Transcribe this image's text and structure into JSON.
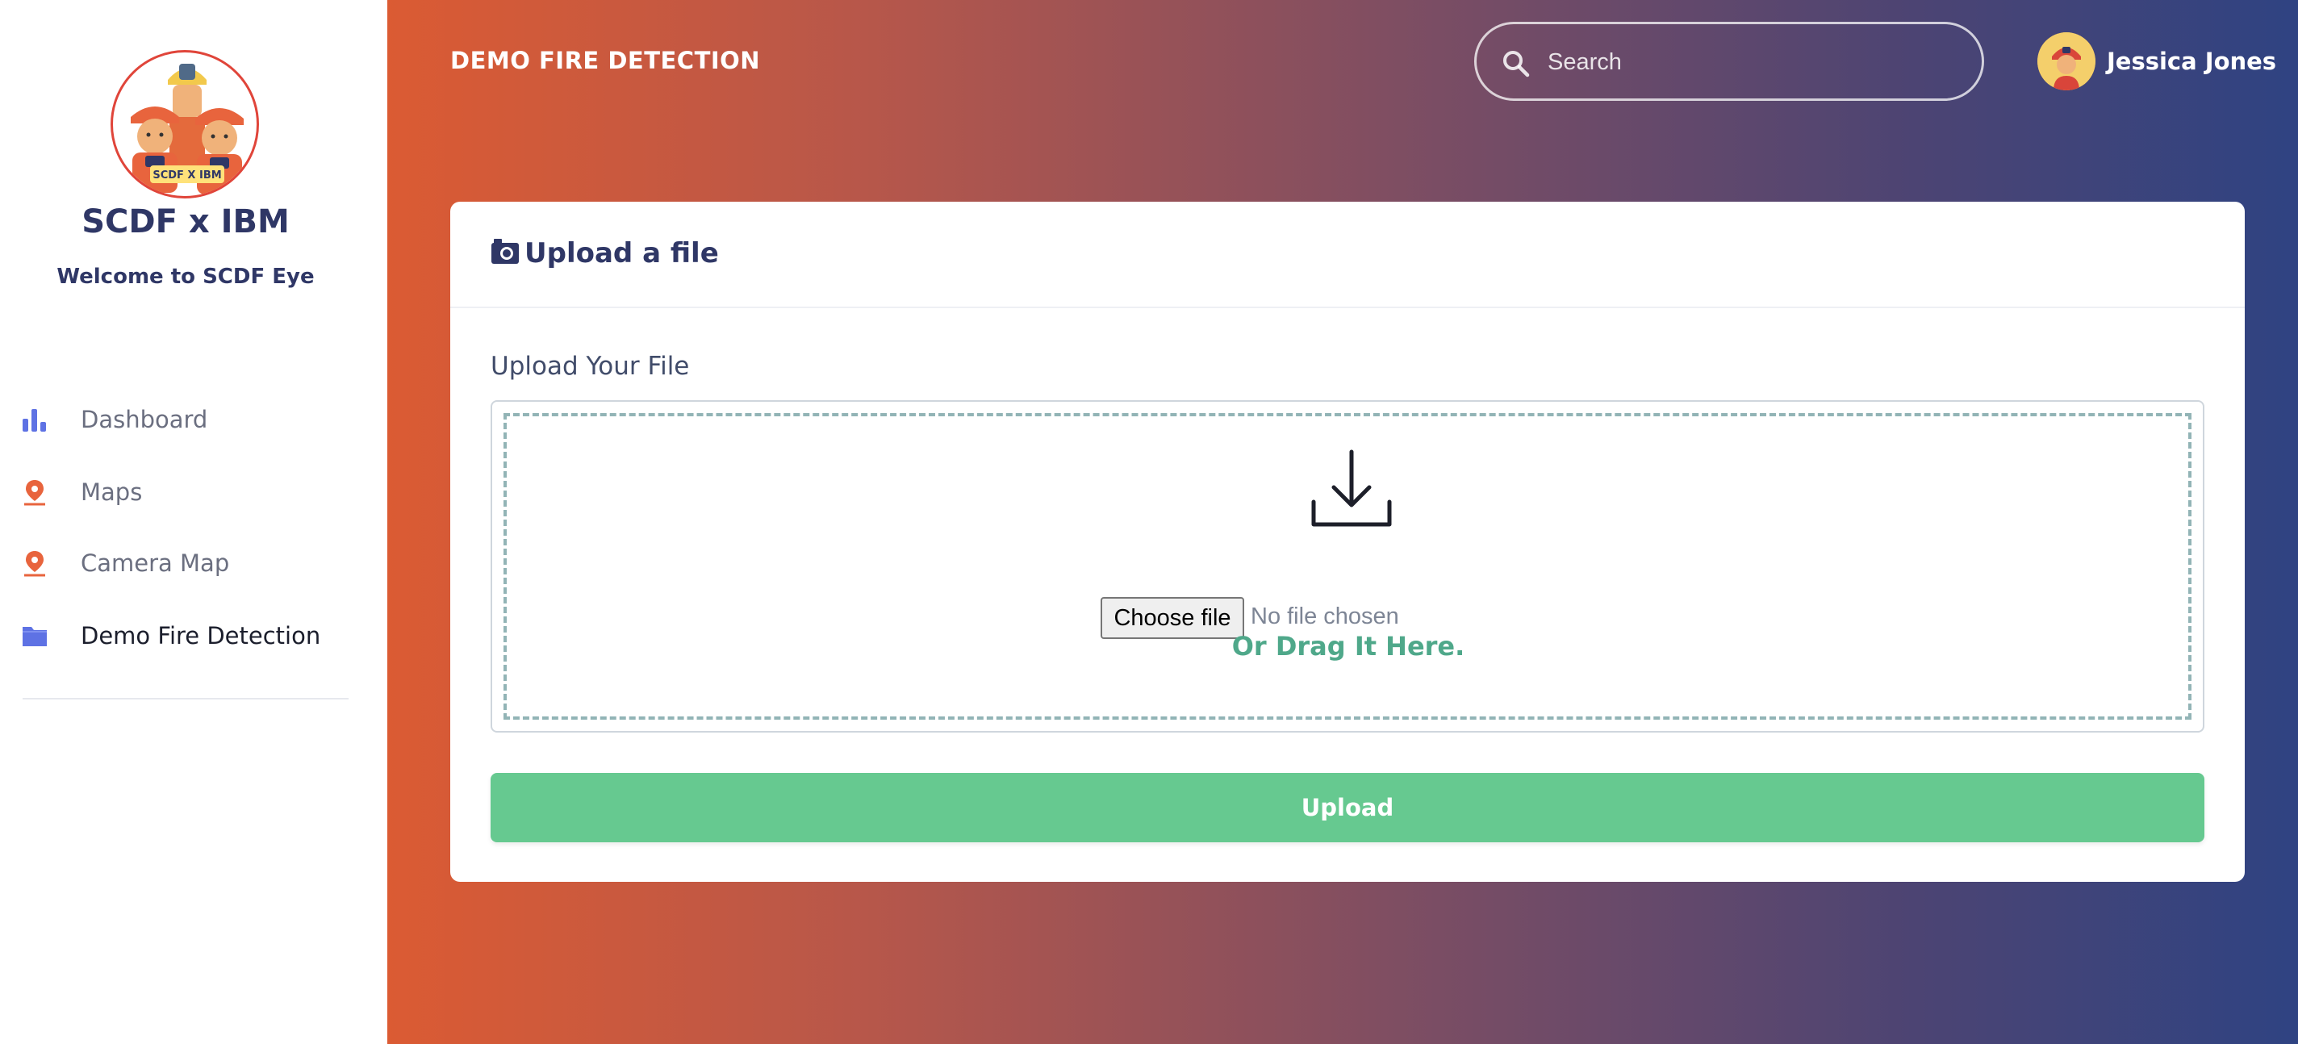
{
  "sidebar": {
    "brand": {
      "logo_text": "SCDF X IBM",
      "title": "SCDF x IBM",
      "welcome_prefix": "Welcome to",
      "welcome_name": "SCDF Eye"
    },
    "items": [
      {
        "label": "Dashboard",
        "icon": "bar-chart-icon",
        "color": "#5e72e4"
      },
      {
        "label": "Maps",
        "icon": "map-pin-icon",
        "color": "#e8643d"
      },
      {
        "label": "Camera Map",
        "icon": "map-pin-icon",
        "color": "#e8643d"
      },
      {
        "label": "Demo Fire Detection",
        "icon": "folder-icon",
        "color": "#5e72e4",
        "active": true
      }
    ]
  },
  "header": {
    "title": "DEMO FIRE DETECTION",
    "search": {
      "placeholder": "Search",
      "value": ""
    },
    "user": {
      "name": "Jessica Jones"
    }
  },
  "card": {
    "title": "Upload a file",
    "field_label": "Upload Your File",
    "file_input": {
      "button_label": "Choose file",
      "status": "No file chosen"
    },
    "drag_hint": "Or Drag It Here.",
    "upload_label": "Upload"
  },
  "colors": {
    "gradient_start": "#db5b33",
    "gradient_end": "#2f4382",
    "primary_text": "#2f3766",
    "success": "#66c990",
    "drag_hint": "#4fa88a"
  }
}
